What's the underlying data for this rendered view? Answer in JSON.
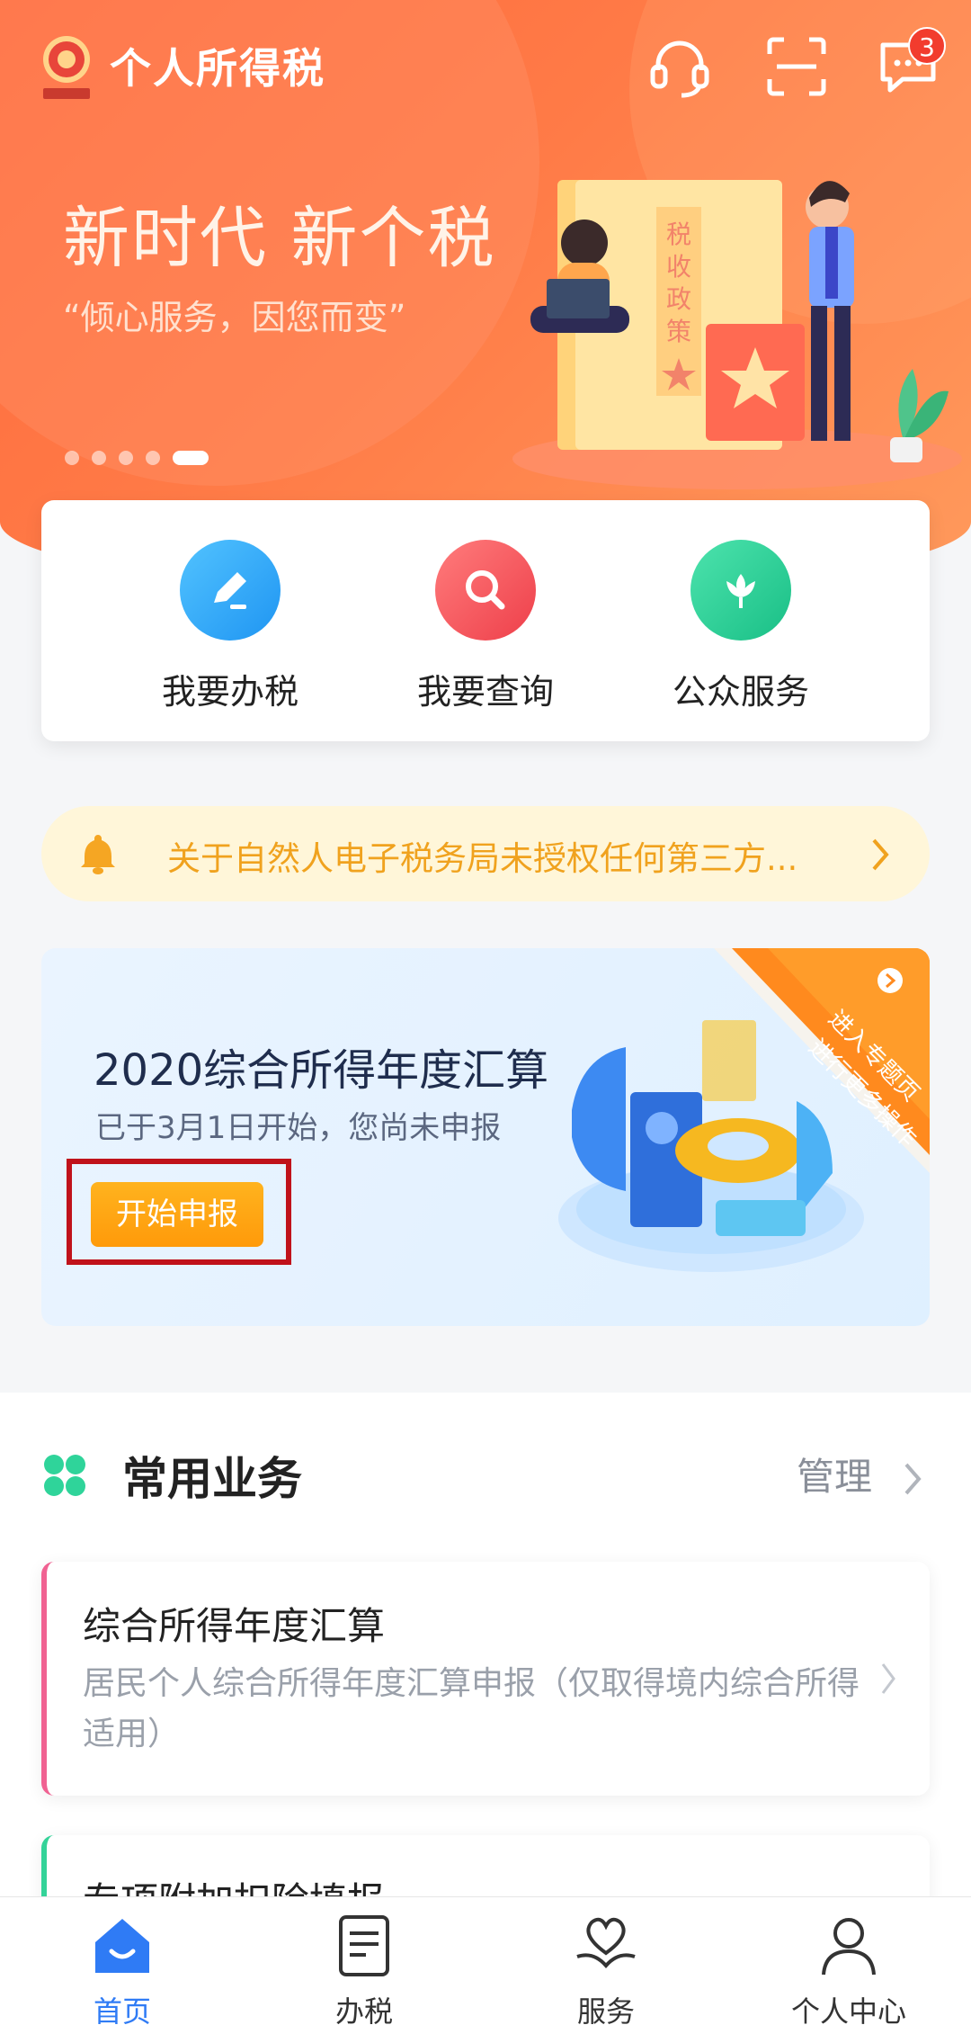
{
  "header": {
    "app_title": "个人所得税",
    "message_badge": "3",
    "icons": [
      "emblem-icon",
      "customer-service-icon",
      "scan-icon",
      "message-icon"
    ]
  },
  "banner": {
    "slogan": "新时代 新个税",
    "subslogan": "“倾心服务，因您而变”",
    "illustration_text": "税收政策",
    "slide_count": 5,
    "active_slide": 5
  },
  "quick_actions": [
    {
      "label": "我要办税",
      "icon": "edit-icon",
      "color": "#2fa7f5"
    },
    {
      "label": "我要查询",
      "icon": "search-icon",
      "color": "#f2555a"
    },
    {
      "label": "公众服务",
      "icon": "flower-icon",
      "color": "#2fcf95"
    }
  ],
  "notice": {
    "text": "关于自然人电子税务局未授权任何第三方...",
    "icon": "bell-icon"
  },
  "annual_card": {
    "title": "2020综合所得年度汇算",
    "subtitle": "已于3月1日开始，您尚未申报",
    "button_label": "开始申报",
    "ribbon_line1": "进入专题页",
    "ribbon_line2": "进行更多操作"
  },
  "common_services": {
    "title": "常用业务",
    "manage_label": "管理",
    "items": [
      {
        "title": "综合所得年度汇算",
        "desc": "居民个人综合所得年度汇算申报（仅取得境内综合所得适用）"
      },
      {
        "title": "专项附加扣除填报",
        "desc": ""
      }
    ]
  },
  "tabbar": [
    {
      "label": "首页",
      "icon": "home-icon",
      "active": true
    },
    {
      "label": "办税",
      "icon": "tax-doc-icon",
      "active": false
    },
    {
      "label": "服务",
      "icon": "heart-hand-icon",
      "active": false
    },
    {
      "label": "个人中心",
      "icon": "person-icon",
      "active": false
    }
  ],
  "colors": {
    "accent": "#2f7bf5",
    "banner": "#ff6a3d",
    "highlight_box": "#c0121b",
    "start_button": "#ffa10f"
  }
}
